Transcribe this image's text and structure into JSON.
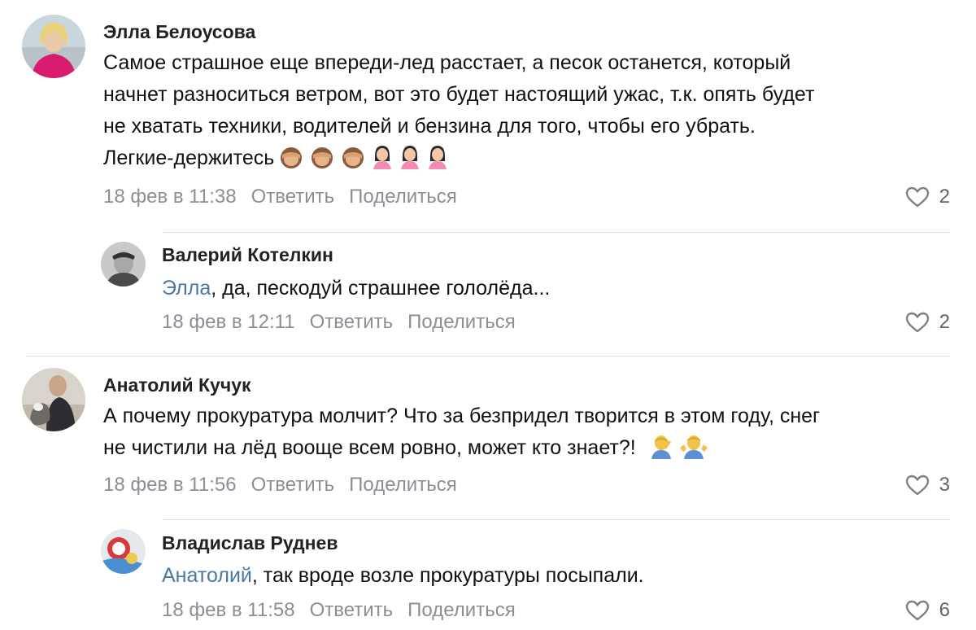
{
  "comments": [
    {
      "author": "Элла Белоусова",
      "lines": [
        "Самое страшное еще впереди-лед расстает, а песок останется, который",
        "начнет разноситься ветром, вот это будет настоящий ужас, т.к. опять будет",
        "не хватать техники, водителей и бензина для того, чтобы его убрать.",
        "Легкие-держитесь"
      ],
      "emojis": [
        "see-no-evil-monkey",
        "see-no-evil-monkey",
        "see-no-evil-monkey",
        "person-girl",
        "person-girl",
        "person-girl"
      ],
      "date": "18 фев в 11:38",
      "reply_label": "Ответить",
      "share_label": "Поделиться",
      "likes": "2"
    },
    {
      "author": "Валерий Котелкин",
      "mention": "Элла",
      "text": ", да, пескодуй страшнее гололёда...",
      "date": "18 фев в 12:11",
      "reply_label": "Ответить",
      "share_label": "Поделиться",
      "likes": "2"
    },
    {
      "author": "Анатолий Кучук",
      "lines": [
        "А почему прокуратура молчит? Что за безпридел творится в этом году, снег",
        "не чистили на лёд вооще всем ровно, может кто знает?!"
      ],
      "emojis": [
        "person-facepalming",
        "person-shrugging"
      ],
      "date": "18 фев в 11:56",
      "reply_label": "Ответить",
      "share_label": "Поделиться",
      "likes": "3"
    },
    {
      "author": "Владислав Руднев",
      "mention": "Анатолий",
      "text": ", так вроде возле прокуратуры посыпали.",
      "date": "18 фев в 11:58",
      "reply_label": "Ответить",
      "share_label": "Поделиться",
      "likes": "6"
    }
  ],
  "colors": {
    "link": "#4a76a8",
    "meta": "#8a8f96",
    "divider": "#dfe2e7"
  }
}
